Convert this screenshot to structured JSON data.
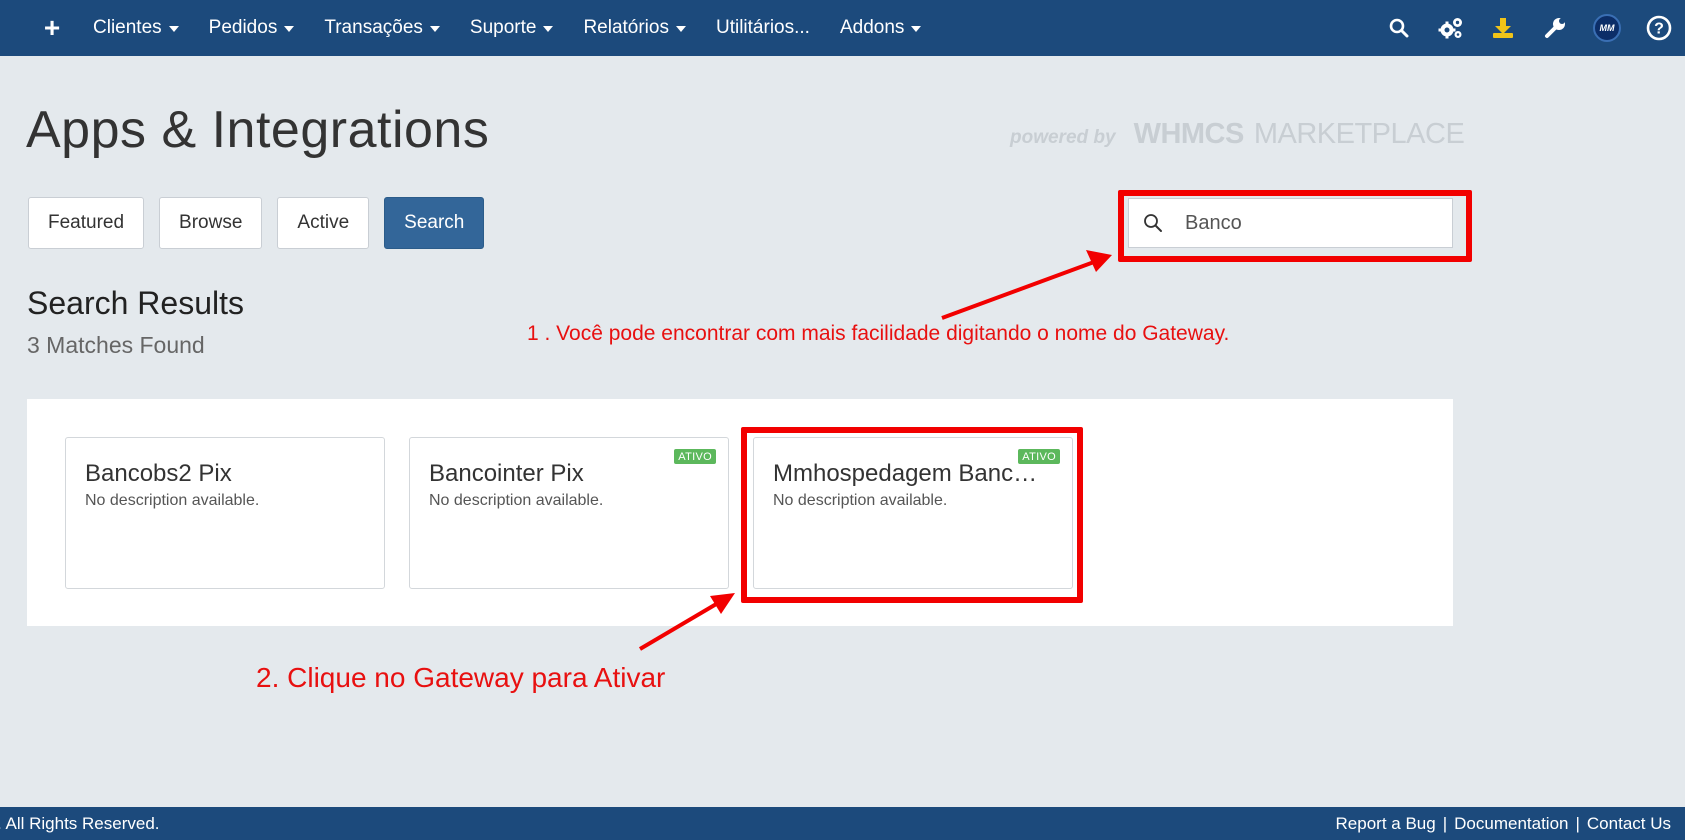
{
  "nav": {
    "menu": [
      {
        "label": "Clientes",
        "caret": true
      },
      {
        "label": "Pedidos",
        "caret": true
      },
      {
        "label": "Transações",
        "caret": true
      },
      {
        "label": "Suporte",
        "caret": true
      },
      {
        "label": "Relatórios",
        "caret": true
      },
      {
        "label": "Utilitários...",
        "caret": false
      },
      {
        "label": "Addons",
        "caret": true
      }
    ],
    "icons": [
      "search-icon",
      "gears-icon",
      "download-icon",
      "wrench-icon",
      "avatar",
      "help-icon"
    ],
    "avatar_initials": "MM",
    "colors": {
      "bar": "#1c4a7c",
      "download_icon": "#f0c419"
    }
  },
  "page": {
    "title": "Apps & Integrations",
    "powered_by": "powered by",
    "powered_brand": "WHMCS",
    "powered_marketplace": "MARKETPLACE"
  },
  "tabs": [
    {
      "label": "Featured",
      "active": false
    },
    {
      "label": "Browse",
      "active": false
    },
    {
      "label": "Active",
      "active": false
    },
    {
      "label": "Search",
      "active": true
    }
  ],
  "search": {
    "value": "Banco",
    "icon": "search-icon"
  },
  "results": {
    "title": "Search Results",
    "count_text": "3 Matches Found",
    "cards": [
      {
        "title": "Bancobs2 Pix",
        "description": "No description available.",
        "badge": ""
      },
      {
        "title": "Bancointer Pix",
        "description": "No description available.",
        "badge": "ATIVO"
      },
      {
        "title": "Mmhospedagem Banco...",
        "description": "No description available.",
        "badge": "ATIVO"
      }
    ]
  },
  "annotations": {
    "note1": "1 . Você pode encontrar com mais facilidade digitando o nome do Gateway.",
    "note2": "2. Clique no Gateway para Ativar",
    "color": "#f20000"
  },
  "footer": {
    "left": ". All Rights Reserved.",
    "links": [
      "Report a Bug",
      "Documentation",
      "Contact Us"
    ],
    "separator": "|"
  }
}
